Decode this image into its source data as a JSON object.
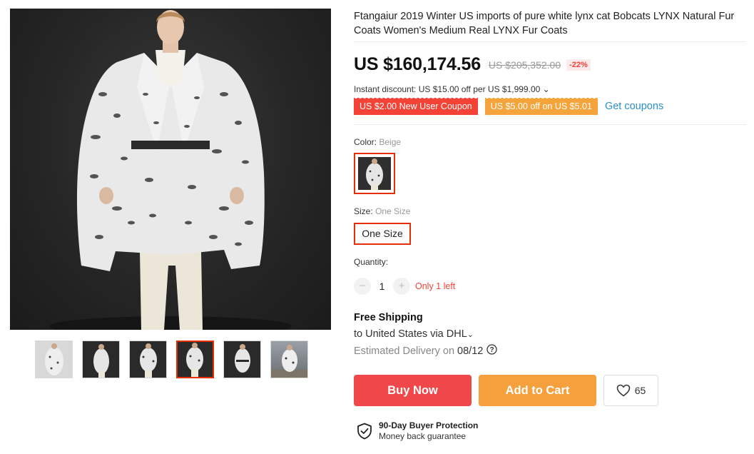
{
  "gallery": {
    "main_image_alt": "",
    "thumbnails": [
      {
        "icon": "coat-photo",
        "style": "light"
      },
      {
        "icon": "coat-photo",
        "style": "dark"
      },
      {
        "icon": "coat-photo",
        "style": "dark"
      },
      {
        "icon": "coat-photo",
        "style": "dark",
        "active": true
      },
      {
        "icon": "coat-photo",
        "style": "dark"
      },
      {
        "icon": "coat-photo",
        "style": "street"
      }
    ]
  },
  "product": {
    "title": "Ftangaiur 2019 Winter US imports of pure white lynx cat Bobcats LYNX Natural Fur Coats Women's Medium Real LYNX Fur Coats",
    "price": "US $160,174.56",
    "original_price": "US $205,352.00",
    "discount": "-22%",
    "instant_discount": "Instant discount: US $15.00 off per US $1,999.00",
    "instant_discount_chevron": "⌄",
    "coupons": [
      {
        "label": "US $2.00 New User Coupon",
        "color": "#f44336"
      },
      {
        "label": "US $5.00 off on US $5.01",
        "color": "#f5a33b"
      }
    ],
    "get_coupons": "Get coupons"
  },
  "options": {
    "color_label": "Color:",
    "color_selected": "Beige",
    "size_label": "Size:",
    "size_selected": "One Size",
    "size_option": "One Size",
    "quantity_label": "Quantity:",
    "quantity_value": "1",
    "minus": "−",
    "plus": "+",
    "stock_note": "Only 1 left"
  },
  "shipping": {
    "title": "Free Shipping",
    "to": "to United States via DHL",
    "to_chevron": "⌄",
    "estimated_label": "Estimated Delivery on",
    "estimated_date": "08/12"
  },
  "actions": {
    "buy_now": "Buy Now",
    "add_to_cart": "Add to Cart",
    "wishlist_count": "65"
  },
  "protection": {
    "title": "90-Day Buyer Protection",
    "subtitle": "Money back guarantee"
  },
  "colors": {
    "accent_red": "#f44336",
    "accent_orange": "#f5a03c",
    "selected_border": "#e62e04",
    "link_blue": "#2a8fc7"
  }
}
